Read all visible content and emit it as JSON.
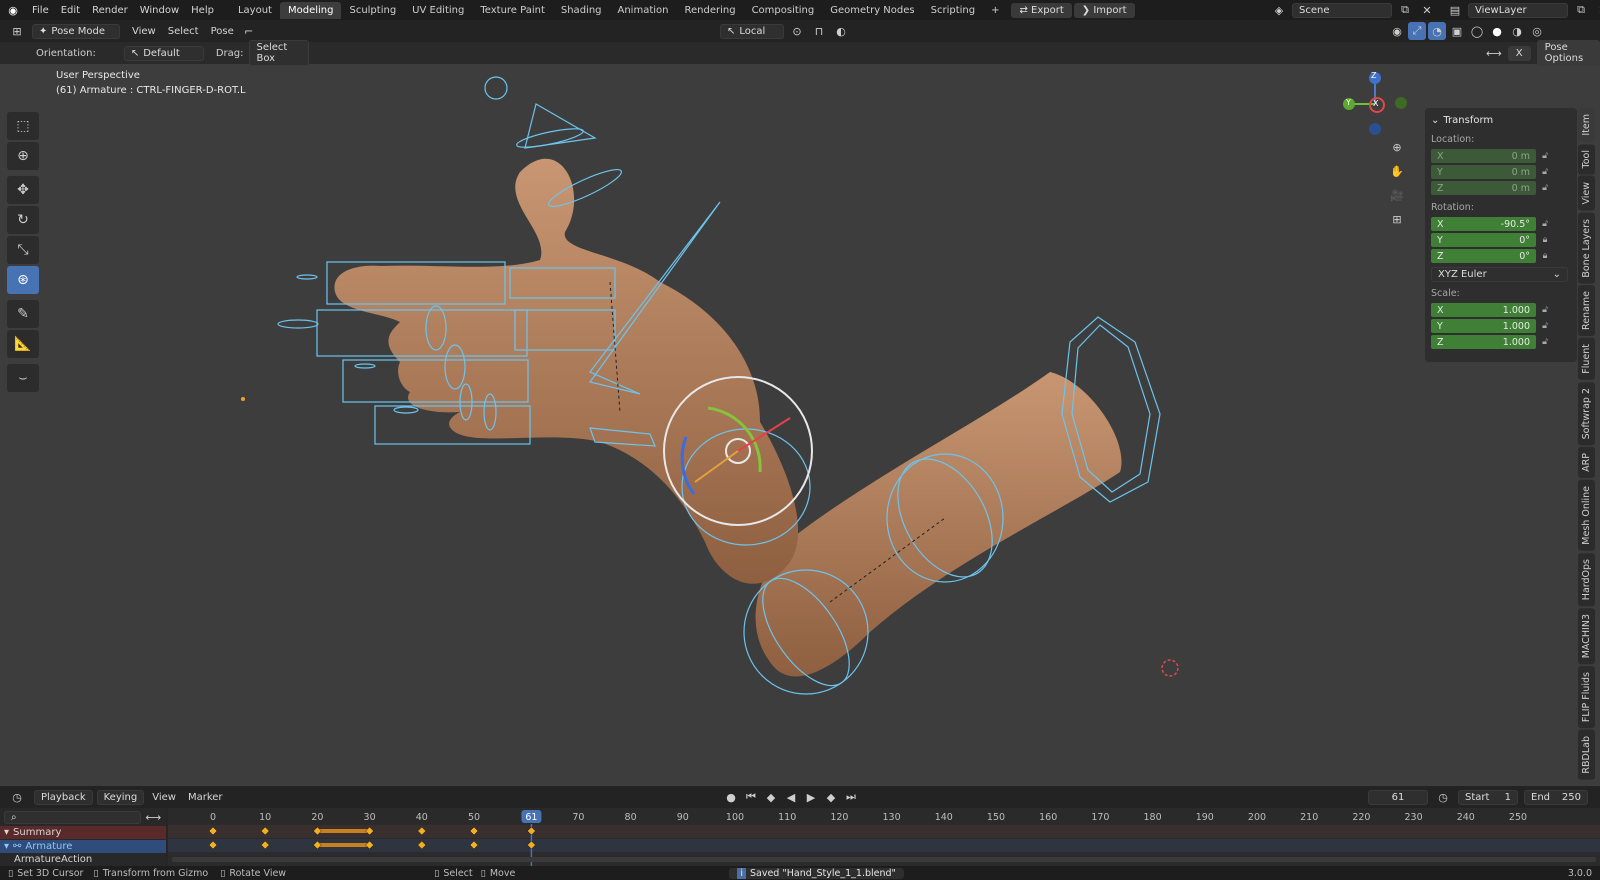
{
  "topbar": {
    "menus": [
      "File",
      "Edit",
      "Render",
      "Window",
      "Help"
    ],
    "workspaces": [
      "Layout",
      "Modeling",
      "Sculpting",
      "UV Editing",
      "Texture Paint",
      "Shading",
      "Animation",
      "Rendering",
      "Compositing",
      "Geometry Nodes",
      "Scripting"
    ],
    "active_workspace": "Modeling",
    "add_tab": "+",
    "export_label": "Export",
    "import_label": "Import",
    "scene": "Scene",
    "view_layer": "ViewLayer"
  },
  "header": {
    "mode": "Pose Mode",
    "menus": [
      "View",
      "Select",
      "Pose"
    ],
    "pivot": "Local",
    "pose_options": "Pose Options"
  },
  "tool_options": {
    "orientation_label": "Orientation:",
    "orientation_value": "Default",
    "drag_label": "Drag:",
    "drag_value": "Select Box",
    "x_label": "X"
  },
  "viewport": {
    "perspective": "User Perspective",
    "active_object": "(61) Armature : CTRL-FINGER-D-ROT.L"
  },
  "gizmo": {
    "x": "X",
    "y": "Y",
    "z": "Z"
  },
  "npanel": {
    "title": "Transform",
    "location_label": "Location:",
    "location": [
      {
        "axis": "X",
        "value": "0 m"
      },
      {
        "axis": "Y",
        "value": "0 m"
      },
      {
        "axis": "Z",
        "value": "0 m"
      }
    ],
    "rotation_label": "Rotation:",
    "rotation": [
      {
        "axis": "X",
        "value": "-90.5°"
      },
      {
        "axis": "Y",
        "value": "0°"
      },
      {
        "axis": "Z",
        "value": "0°"
      }
    ],
    "rotation_mode": "XYZ Euler",
    "scale_label": "Scale:",
    "scale": [
      {
        "axis": "X",
        "value": "1.000"
      },
      {
        "axis": "Y",
        "value": "1.000"
      },
      {
        "axis": "Z",
        "value": "1.000"
      }
    ],
    "tabs": [
      "Item",
      "Tool",
      "View",
      "Bone Layers",
      "Rename",
      "Fluent",
      "Softwrap 2",
      "ARP",
      "Mesh Online",
      "HardOps",
      "MACHIN3",
      "FLIP Fluids",
      "RBDLab"
    ]
  },
  "timeline": {
    "menus": [
      "Playback",
      "Keying",
      "View",
      "Marker"
    ],
    "current_frame": "61",
    "start_label": "Start",
    "start": "1",
    "end_label": "End",
    "end": "250",
    "ruler": [
      "0",
      "10",
      "20",
      "30",
      "40",
      "50",
      "61",
      "70",
      "80",
      "90",
      "100",
      "110",
      "120",
      "130",
      "140",
      "150",
      "160",
      "170",
      "180",
      "190",
      "200",
      "210",
      "220",
      "230",
      "240",
      "250"
    ],
    "channels": [
      "Summary",
      "Armature",
      "ArmatureAction"
    ],
    "keyframes": [
      0,
      10,
      20,
      30,
      40,
      50,
      61
    ],
    "hold_range": [
      20,
      30
    ]
  },
  "status": {
    "items": [
      "Set 3D Cursor",
      "Transform from Gizmo",
      "Rotate View",
      "Select",
      "Move"
    ],
    "message": "Saved \"Hand_Style_1_1.blend\"",
    "version": "3.0.0"
  }
}
